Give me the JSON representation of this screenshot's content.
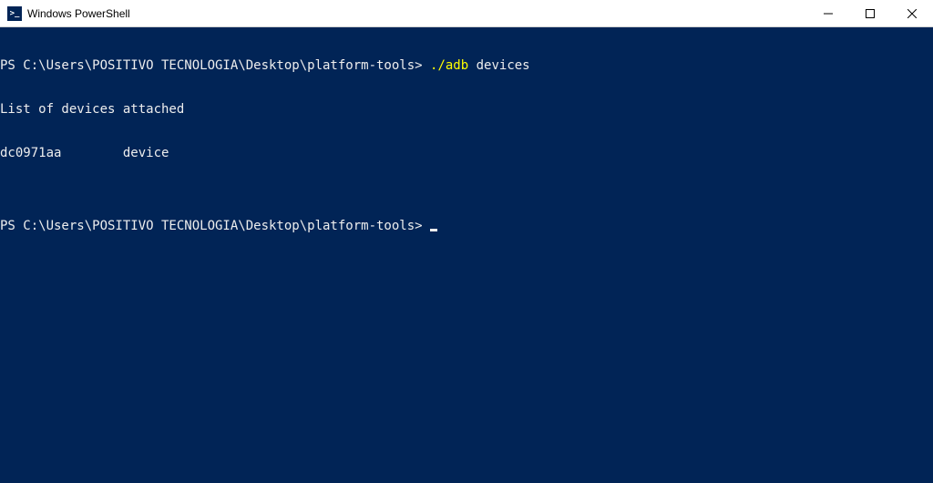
{
  "window": {
    "title": "Windows PowerShell",
    "icon_label": ">_"
  },
  "terminal": {
    "prompt1_prefix": "PS C:\\Users\\POSITIVO TECNOLOGIA\\Desktop\\platform-tools> ",
    "cmd_part1": "./adb",
    "cmd_part2": " devices",
    "output_line1": "List of devices attached",
    "output_line2": "dc0971aa        device",
    "blank_line": "",
    "prompt2": "PS C:\\Users\\POSITIVO TECNOLOGIA\\Desktop\\platform-tools> "
  }
}
